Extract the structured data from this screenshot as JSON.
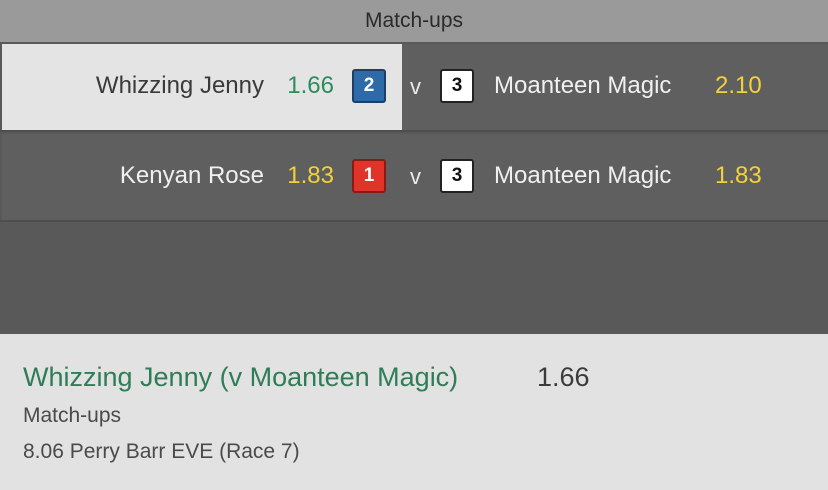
{
  "header": {
    "title": "Match-ups"
  },
  "matchups": [
    {
      "left_name": "Whizzing Jenny",
      "left_odds": "1.66",
      "left_number": "2",
      "vs": "v",
      "right_number": "3",
      "right_name": "Moanteen Magic",
      "right_odds": "2.10",
      "selected": true
    },
    {
      "left_name": "Kenyan Rose",
      "left_odds": "1.83",
      "left_number": "1",
      "vs": "v",
      "right_number": "3",
      "right_name": "Moanteen Magic",
      "right_odds": "1.83",
      "selected": false
    }
  ],
  "colors": {
    "selected_bg": "#e4e4e4",
    "odds_green": "#2e8b5c",
    "odds_yellow": "#f2d13b",
    "badge_blue": "#2f6aa8",
    "badge_red": "#e0342b"
  },
  "bet_slip": {
    "selection": "Whizzing Jenny (v Moanteen Magic)",
    "odds": "1.66",
    "market": "Match-ups",
    "event": "8.06 Perry Barr EVE (Race 7)"
  }
}
